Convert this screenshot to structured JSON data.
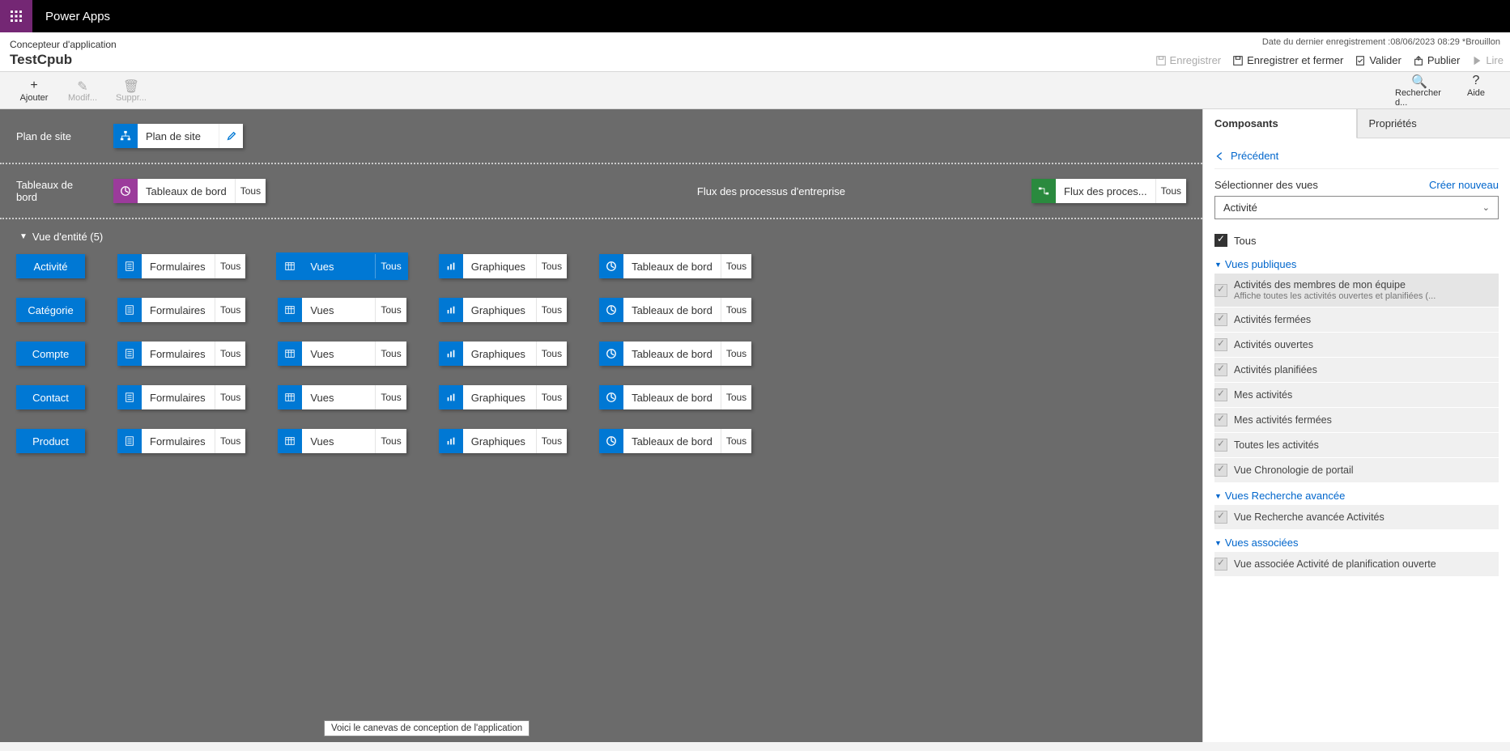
{
  "app_title": "Power Apps",
  "subheader": {
    "designer_label": "Concepteur d'application",
    "app_name": "TestCpub",
    "last_save": "Date du dernier enregistrement :08/06/2023 08:29 *Brouillon",
    "actions": {
      "save": "Enregistrer",
      "save_close": "Enregistrer et fermer",
      "validate": "Valider",
      "publish": "Publier",
      "read": "Lire"
    }
  },
  "toolbar": {
    "add": "Ajouter",
    "edit": "Modif...",
    "delete": "Suppr...",
    "search": "Rechercher d...",
    "help": "Aide"
  },
  "canvas": {
    "sitemap": {
      "label": "Plan de site",
      "tile": "Plan de site"
    },
    "dashboards": {
      "label": "Tableaux de bord",
      "tile": "Tableaux de bord",
      "badge": "Tous"
    },
    "bpf": {
      "label": "Flux des processus d'entreprise",
      "tile": "Flux des proces...",
      "badge": "Tous"
    },
    "entity_header": "Vue d'entité (5)",
    "cols": {
      "forms": "Formulaires",
      "views": "Vues",
      "charts": "Graphiques",
      "dashboards": "Tableaux de bord",
      "badge": "Tous"
    },
    "entities": [
      "Activité",
      "Catégorie",
      "Compte",
      "Contact",
      "Product"
    ],
    "tooltip": "Voici le canevas de conception de l'application"
  },
  "panel": {
    "tab_components": "Composants",
    "tab_properties": "Propriétés",
    "back": "Précédent",
    "select_views": "Sélectionner des vues",
    "create_new": "Créer nouveau",
    "dropdown_value": "Activité",
    "all": "Tous",
    "cat_public": "Vues publiques",
    "cat_advfind": "Vues Recherche avancée",
    "cat_assoc": "Vues associées",
    "public_views": [
      {
        "name": "Activités des membres de mon équipe",
        "desc": "Affiche toutes les activités ouvertes et planifiées (..."
      },
      {
        "name": "Activités fermées"
      },
      {
        "name": "Activités ouvertes"
      },
      {
        "name": "Activités planifiées"
      },
      {
        "name": "Mes activités"
      },
      {
        "name": "Mes activités fermées"
      },
      {
        "name": "Toutes les activités"
      },
      {
        "name": "Vue Chronologie de portail"
      }
    ],
    "advfind_views": [
      {
        "name": "Vue Recherche avancée Activités"
      }
    ],
    "assoc_views": [
      {
        "name": "Vue associée Activité de planification ouverte"
      }
    ]
  }
}
